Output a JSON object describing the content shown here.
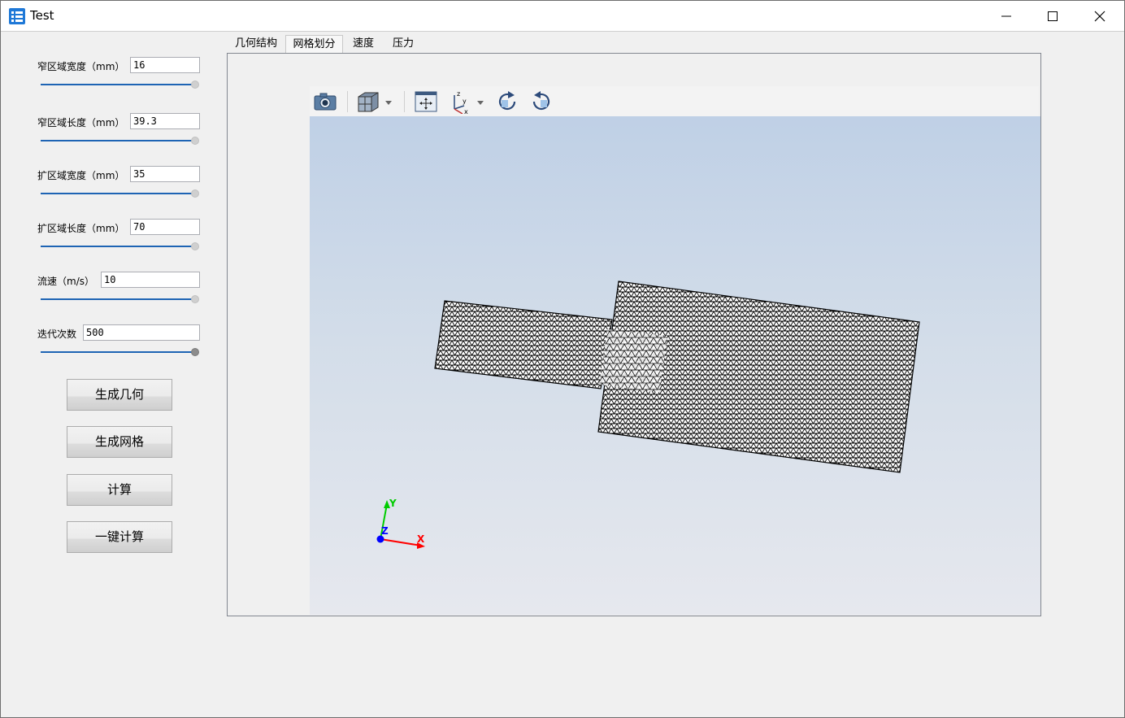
{
  "window": {
    "title": "Test"
  },
  "params": [
    {
      "label": "窄区域宽度（mm）",
      "value": "16"
    },
    {
      "label": "窄区域长度（mm）",
      "value": "39.3"
    },
    {
      "label": "扩区域宽度（mm）",
      "value": "35"
    },
    {
      "label": "扩区域长度（mm）",
      "value": "70"
    },
    {
      "label": "流速（m/s）",
      "value": "10"
    },
    {
      "label": "迭代次数",
      "value": "500"
    }
  ],
  "buttons": {
    "generate_geometry": "生成几何",
    "generate_mesh": "生成网格",
    "compute": "计算",
    "one_click": "一键计算"
  },
  "tabs": [
    {
      "label": "几何结构",
      "active": false
    },
    {
      "label": "网格划分",
      "active": true
    },
    {
      "label": "速度",
      "active": false
    },
    {
      "label": "压力",
      "active": false
    }
  ],
  "toolbar": {
    "icons": [
      "camera-icon",
      "cube-view-icon",
      "fit-view-icon",
      "axes-orientation-icon",
      "rotate-cw-icon",
      "rotate-ccw-icon"
    ]
  },
  "axes": {
    "x": "X",
    "y": "Y",
    "z": "Z"
  },
  "colors": {
    "accent": "#1e64b4",
    "mesh": "#000000",
    "x_axis": "#ff0000",
    "y_axis": "#00cc00",
    "z_axis": "#0000ff"
  }
}
